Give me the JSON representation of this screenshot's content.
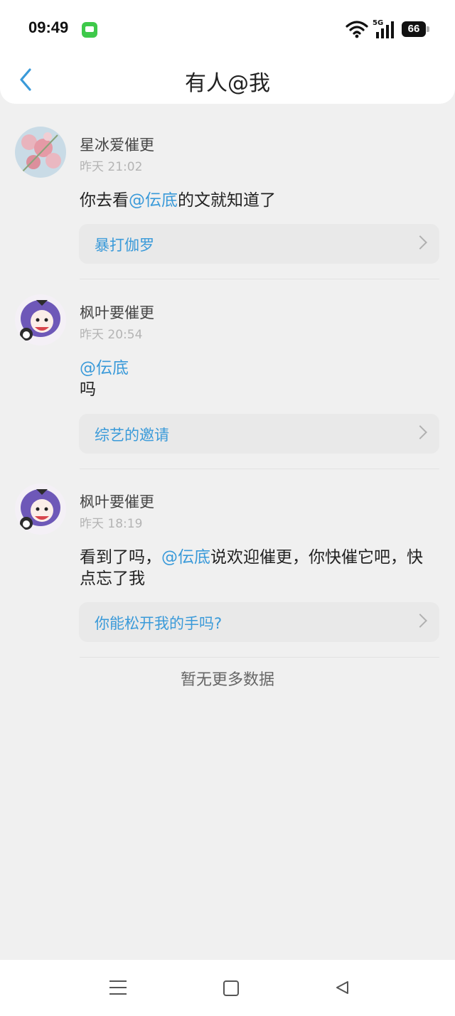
{
  "status_bar": {
    "time": "09:49",
    "network_label": "5G",
    "battery_level": "66",
    "icons": [
      "message-app-icon",
      "wifi-icon",
      "signal-icon",
      "battery-icon"
    ]
  },
  "header": {
    "title": "有人@我",
    "back_icon": "chevron-left-icon",
    "accent_color": "#3a9ad9"
  },
  "mentions": [
    {
      "user": "星冰爱催更",
      "time": "昨天 21:02",
      "text_before": "你去看",
      "mention": "@伝底",
      "text_after": "的文就知道了",
      "card_title": "暴打伽罗"
    },
    {
      "user": "枫叶要催更",
      "time": "昨天 20:54",
      "mention": "@伝底",
      "text_after": "吗",
      "card_title": "综艺的邀请"
    },
    {
      "user": "枫叶要催更",
      "time": "昨天 18:19",
      "text_before": "看到了吗，",
      "mention": "@伝底",
      "text_after": "说欢迎催更，你快催它吧，快点忘了我",
      "card_title": "你能松开我的手吗?"
    }
  ],
  "footer": {
    "no_more": "暂无更多数据"
  },
  "nav_bar": {
    "icons": [
      "menu-icon",
      "home-icon",
      "back-triangle-icon"
    ]
  }
}
